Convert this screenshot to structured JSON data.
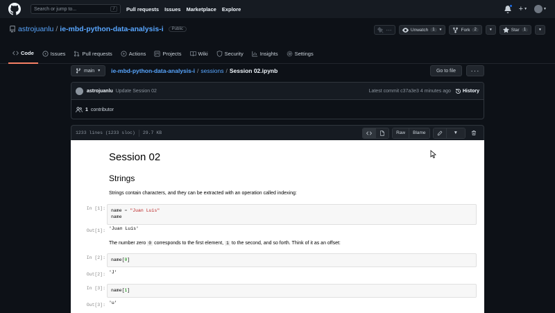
{
  "header": {
    "search_placeholder": "Search or jump to...",
    "search_shortcut": "/",
    "nav": [
      "Pull requests",
      "Issues",
      "Marketplace",
      "Explore"
    ]
  },
  "repo": {
    "owner": "astrojuanlu",
    "sep": "/",
    "name": "ie-mbd-python-data-analysis-i",
    "visibility": "Public",
    "unwatch_label": "Unwatch",
    "watch_count": "1",
    "fork_label": "Fork",
    "fork_count": "2",
    "star_label": "Star",
    "star_count": "1",
    "tabs": [
      {
        "label": "Code",
        "icon": "code-icon"
      },
      {
        "label": "Issues",
        "icon": "issue-icon"
      },
      {
        "label": "Pull requests",
        "icon": "pull-request-icon"
      },
      {
        "label": "Actions",
        "icon": "play-icon"
      },
      {
        "label": "Projects",
        "icon": "project-icon"
      },
      {
        "label": "Wiki",
        "icon": "book-icon"
      },
      {
        "label": "Security",
        "icon": "shield-icon"
      },
      {
        "label": "Insights",
        "icon": "graph-icon"
      },
      {
        "label": "Settings",
        "icon": "gear-icon"
      }
    ]
  },
  "breadcrumb": {
    "branch": "main",
    "repo": "ie-mbd-python-data-analysis-i",
    "folder": "sessions",
    "file": "Session 02.ipynb",
    "go_to_file": "Go to file",
    "more": "···"
  },
  "commit": {
    "author": "astrojuanlu",
    "message": "Update Session 02",
    "latest": "Latest commit c37a3e3 4 minutes ago",
    "history": "History",
    "contributors_count": "1",
    "contributors_label": "contributor"
  },
  "file": {
    "lines": "1233 lines (1233 sloc)",
    "size": "29.7 KB",
    "raw": "Raw",
    "blame": "Blame"
  },
  "notebook": {
    "title": "Session 02",
    "section": "Strings",
    "intro": "Strings contain characters, and they can be extracted with an operation called indexing:",
    "cell1_prompt": "In [1]:",
    "cell1_line1_a": "name ",
    "cell1_line1_op": "=",
    "cell1_line1_str": " \"Juan Luis\"",
    "cell1_line2": "name",
    "out1_prompt": "Out[1]:",
    "out1": "'Juan Luis'",
    "para2_a": "The number zero ",
    "para2_c1": "0",
    "para2_b": " corresponds to the first element, ",
    "para2_c2": "1",
    "para2_c": " to the second, and so forth. Think of it as an offset:",
    "cell2_prompt": "In [2]:",
    "cell2_a": "name[",
    "cell2_n": "0",
    "cell2_b": "]",
    "out2_prompt": "Out[2]:",
    "out2": "'J'",
    "cell3_prompt": "In [3]:",
    "cell3_a": "name[",
    "cell3_n": "1",
    "cell3_b": "]",
    "out3_prompt": "Out[3]:",
    "out3": "'u'"
  }
}
